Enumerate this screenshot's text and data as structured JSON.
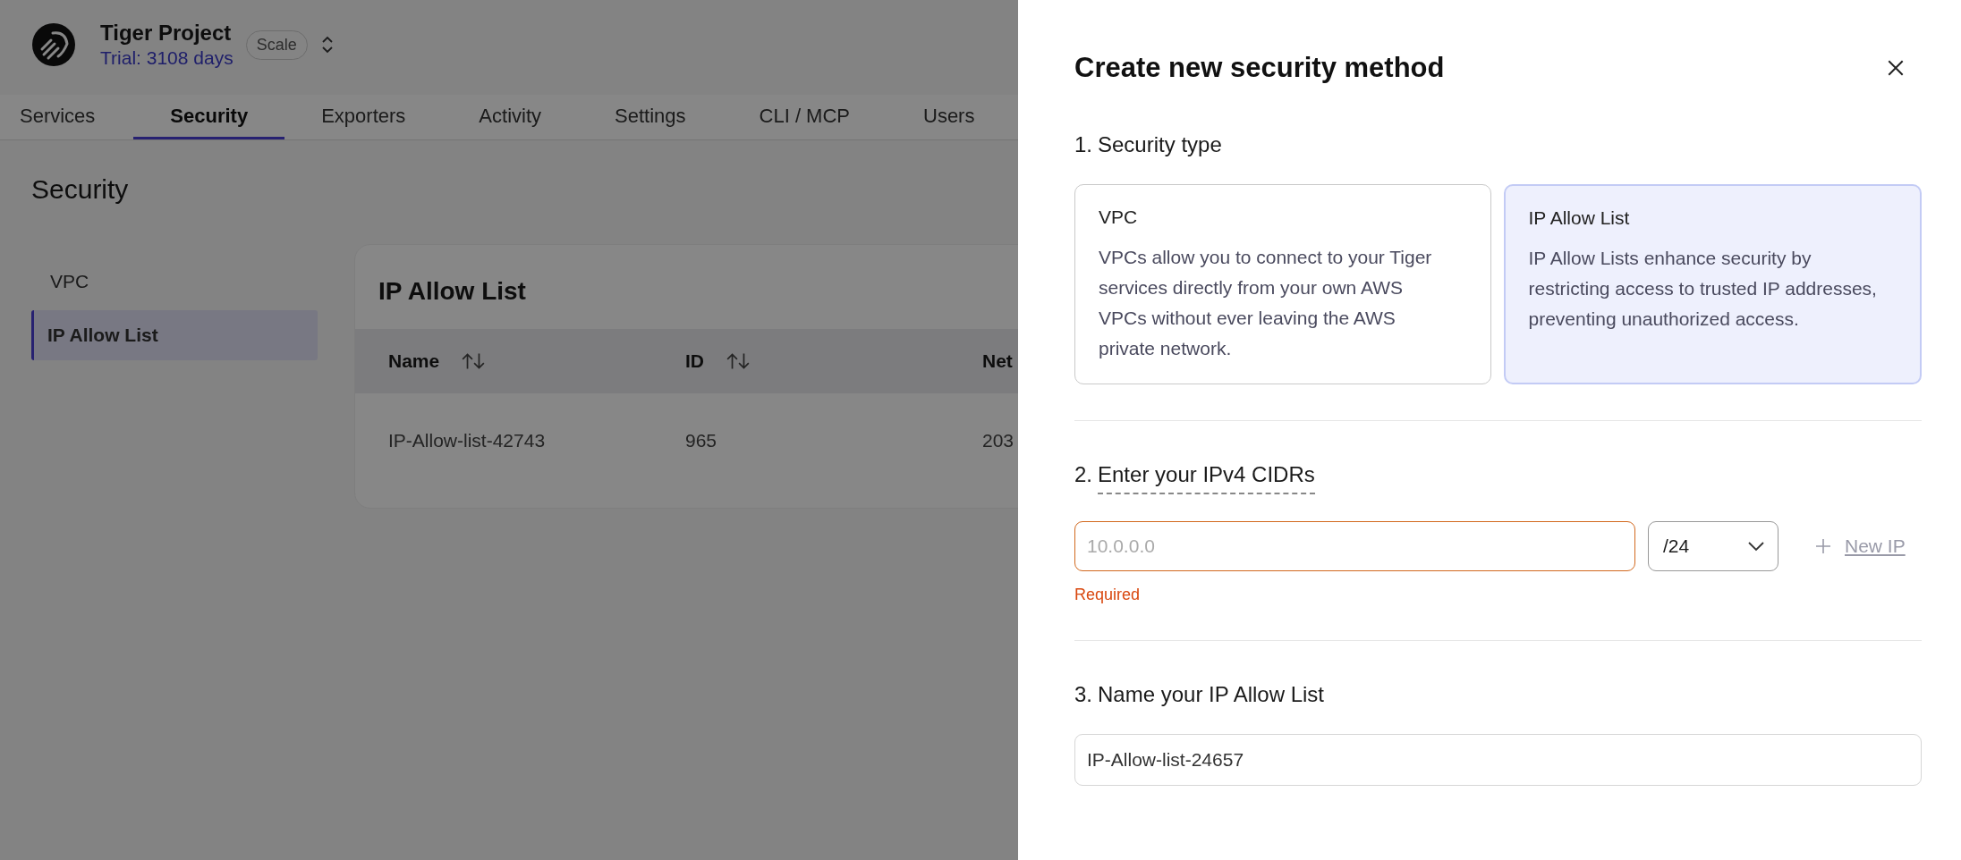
{
  "project": {
    "name": "Tiger Project",
    "trial": "Trial: 3108 days",
    "plan": "Scale"
  },
  "tabs": [
    {
      "label": "Services",
      "selected": false
    },
    {
      "label": "Security",
      "selected": true
    },
    {
      "label": "Exporters",
      "selected": false
    },
    {
      "label": "Activity",
      "selected": false
    },
    {
      "label": "Settings",
      "selected": false
    },
    {
      "label": "CLI / MCP",
      "selected": false
    },
    {
      "label": "Users",
      "selected": false
    }
  ],
  "page_title": "Security",
  "sidebar": {
    "items": [
      {
        "label": "VPC",
        "selected": false
      },
      {
        "label": "IP Allow List",
        "selected": true
      }
    ]
  },
  "table": {
    "title": "IP Allow List",
    "columns": [
      {
        "label": "Name",
        "sortable": true
      },
      {
        "label": "ID",
        "sortable": true
      },
      {
        "label": "Net",
        "sortable": false
      }
    ],
    "rows": [
      [
        "IP-Allow-list-42743",
        "965",
        "203"
      ]
    ]
  },
  "drawer": {
    "title": "Create new security method",
    "sections": [
      {
        "kind": "type_choice",
        "number": "1.",
        "label": "Security type",
        "has_tooltip": false,
        "options": [
          {
            "title": "VPC",
            "description": "VPCs allow you to connect to your Tiger services directly from your own AWS VPCs without ever leaving the AWS private network.",
            "selected": false
          },
          {
            "title": "IP Allow List",
            "description": "IP Allow Lists enhance security by restricting access to trusted IP addresses, preventing unauthorized access.",
            "selected": true
          }
        ]
      },
      {
        "kind": "cidr",
        "number": "2.",
        "label": "Enter your IPv4 CIDRs",
        "has_tooltip": true,
        "ip_field": {
          "placeholder": "10.0.0.0",
          "invalid": true,
          "error": "Required"
        },
        "mask_select": {
          "value": "/24"
        },
        "add_button": "New IP"
      },
      {
        "kind": "name",
        "number": "3.",
        "label": "Name your IP Allow List",
        "has_tooltip": false,
        "name_field": {
          "value": "IP-Allow-list-24657"
        }
      }
    ]
  }
}
